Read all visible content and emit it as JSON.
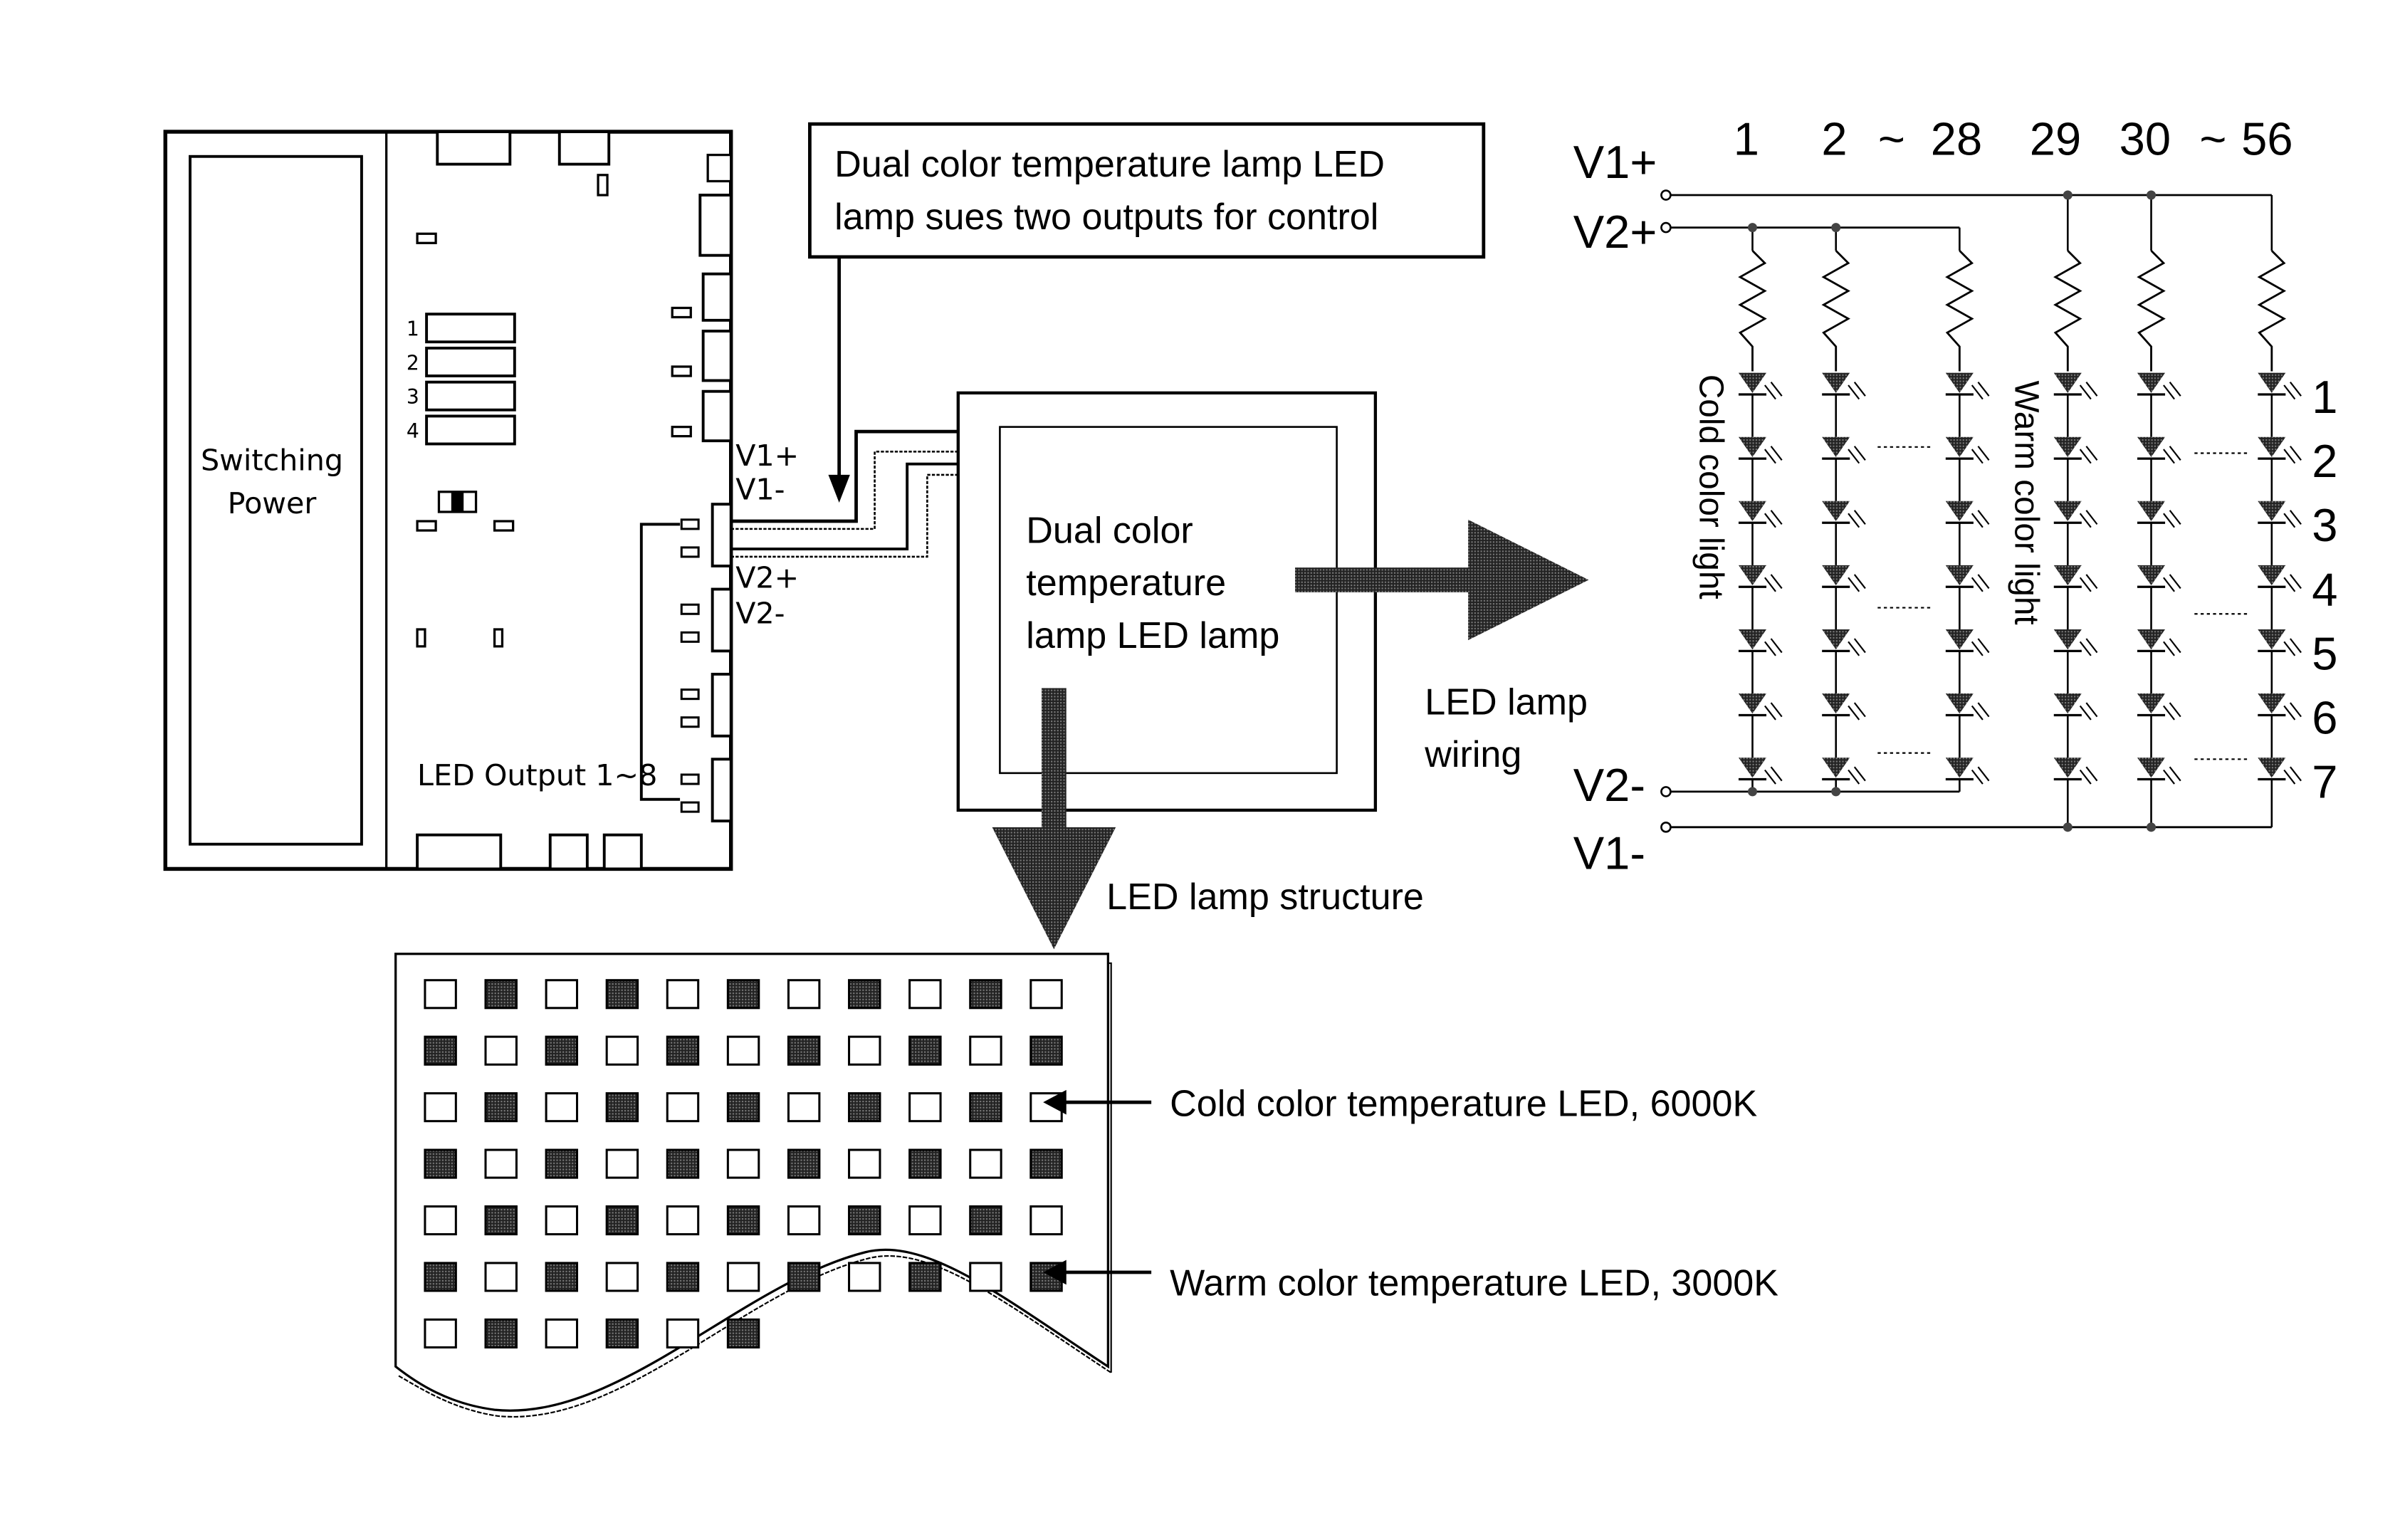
{
  "controller": {
    "power_label_line1": "Switching",
    "power_label_line2": "Power",
    "dip_numbers": [
      "1",
      "2",
      "3",
      "4"
    ],
    "output_label": "LED Output 1~8",
    "terminal_labels": [
      "V1+",
      "V1-",
      "V2+",
      "V2-"
    ]
  },
  "callout": {
    "line1": "Dual color temperature lamp LED",
    "line2": "lamp sues two outputs for control"
  },
  "lamp": {
    "line1": "Dual color",
    "line2": "temperature",
    "line3": "lamp LED lamp"
  },
  "arrows": {
    "wiring_label_line1": "LED lamp",
    "wiring_label_line2": "wiring",
    "structure_label": "LED lamp structure"
  },
  "circuit": {
    "rails": [
      "V1+",
      "V2+",
      "V2-",
      "V1-"
    ],
    "column_headers": [
      "1",
      "2",
      "~",
      "28",
      "29",
      "30",
      "~",
      "56"
    ],
    "row_numbers": [
      "1",
      "2",
      "3",
      "4",
      "5",
      "6",
      "7"
    ],
    "cold_label": "Cold color light",
    "warm_label": "Warm color light",
    "cold_columns": 3,
    "warm_columns": 3,
    "leds_per_string": 7
  },
  "structure": {
    "rows": [
      [
        "C",
        "W",
        "C",
        "W",
        "C",
        "W",
        "C",
        "W",
        "C",
        "W",
        "C"
      ],
      [
        "W",
        "C",
        "W",
        "C",
        "W",
        "C",
        "W",
        "C",
        "W",
        "C",
        "W"
      ],
      [
        "C",
        "W",
        "C",
        "W",
        "C",
        "W",
        "C",
        "W",
        "C",
        "W",
        "C"
      ],
      [
        "W",
        "C",
        "W",
        "C",
        "W",
        "C",
        "W",
        "C",
        "W",
        "C",
        "W"
      ],
      [
        "C",
        "W",
        "C",
        "W",
        "C",
        "W",
        "C",
        "W",
        "C",
        "W",
        "C"
      ],
      [
        "W",
        "C",
        "W",
        "C",
        "W",
        "C",
        "W",
        "C",
        "W",
        "C",
        "W"
      ],
      [
        "C",
        "W",
        "C",
        "W",
        "C",
        "W"
      ]
    ],
    "legend_cold": "Cold color temperature LED, 6000K",
    "legend_warm": "Warm color temperature LED, 3000K"
  }
}
